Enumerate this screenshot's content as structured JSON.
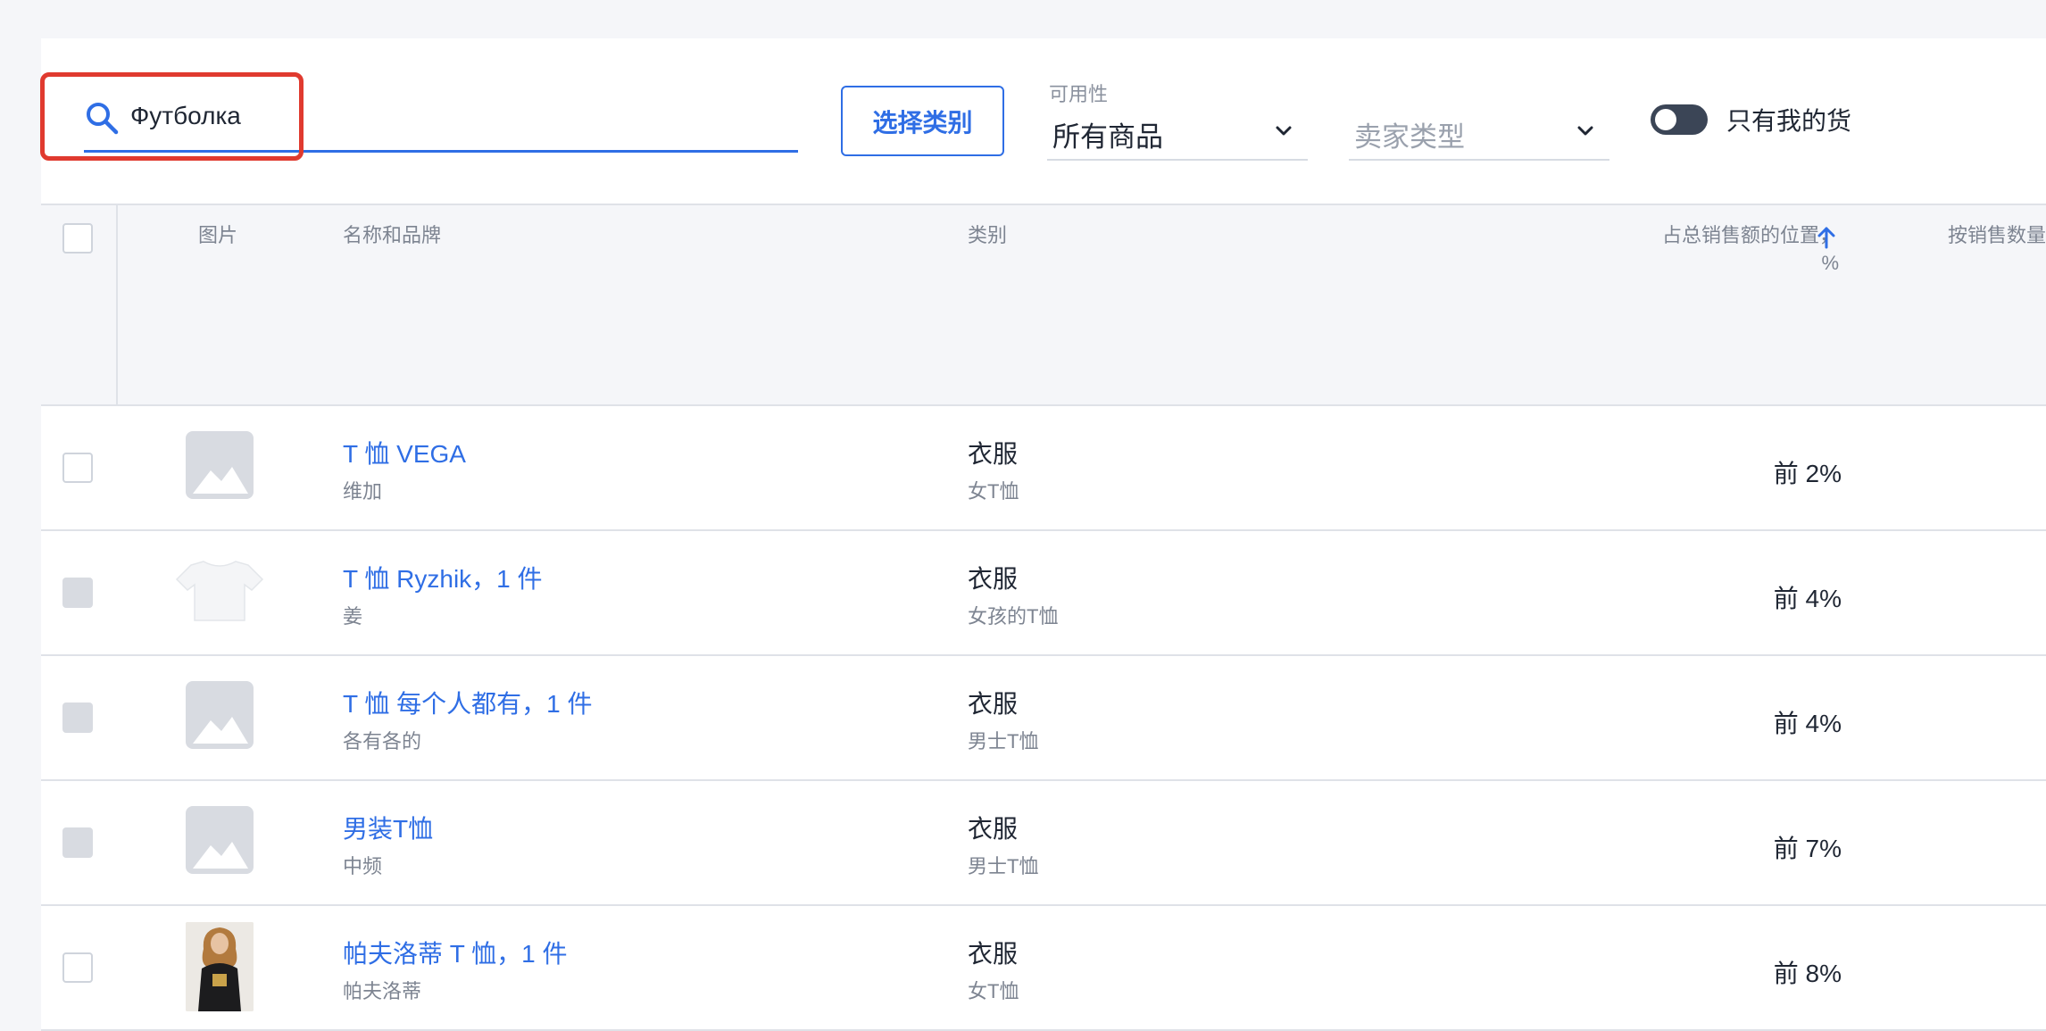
{
  "search": {
    "value": "Футболка"
  },
  "filters": {
    "category_button": "选择类别",
    "availability": {
      "label": "可用性",
      "value": "所有商品"
    },
    "seller_type": {
      "placeholder": "卖家类型"
    },
    "toggle_label": "只有我的货"
  },
  "table": {
    "headers": {
      "image": "图片",
      "name": "名称和品牌",
      "category": "类别",
      "share": "占总销售额的位置，\n%",
      "quantity": "按销售数量"
    },
    "rows": [
      {
        "name": "T 恤 VEGA",
        "brand": "维加",
        "category": "衣服",
        "subcategory": "女T恤",
        "share": "前 2%",
        "image": "placeholder"
      },
      {
        "name": "T 恤 Ryzhik，1 件",
        "brand": "姜",
        "category": "衣服",
        "subcategory": "女孩的T恤",
        "share": "前 4%",
        "image": "white-tshirt"
      },
      {
        "name": "T 恤 每个人都有，1 件",
        "brand": "各有各的",
        "category": "衣服",
        "subcategory": "男士T恤",
        "share": "前 4%",
        "image": "placeholder"
      },
      {
        "name": "男装T恤",
        "brand": "中频",
        "category": "衣服",
        "subcategory": "男士T恤",
        "share": "前 7%",
        "image": "placeholder"
      },
      {
        "name": "帕夫洛蒂 T 恤，1 件",
        "brand": "帕夫洛蒂",
        "category": "衣服",
        "subcategory": "女T恤",
        "share": "前 8%",
        "image": "photo-woman"
      }
    ]
  },
  "colors": {
    "accent": "#2f6ee5",
    "highlight": "#e03a2f",
    "header_bg": "#f5f6f9"
  }
}
